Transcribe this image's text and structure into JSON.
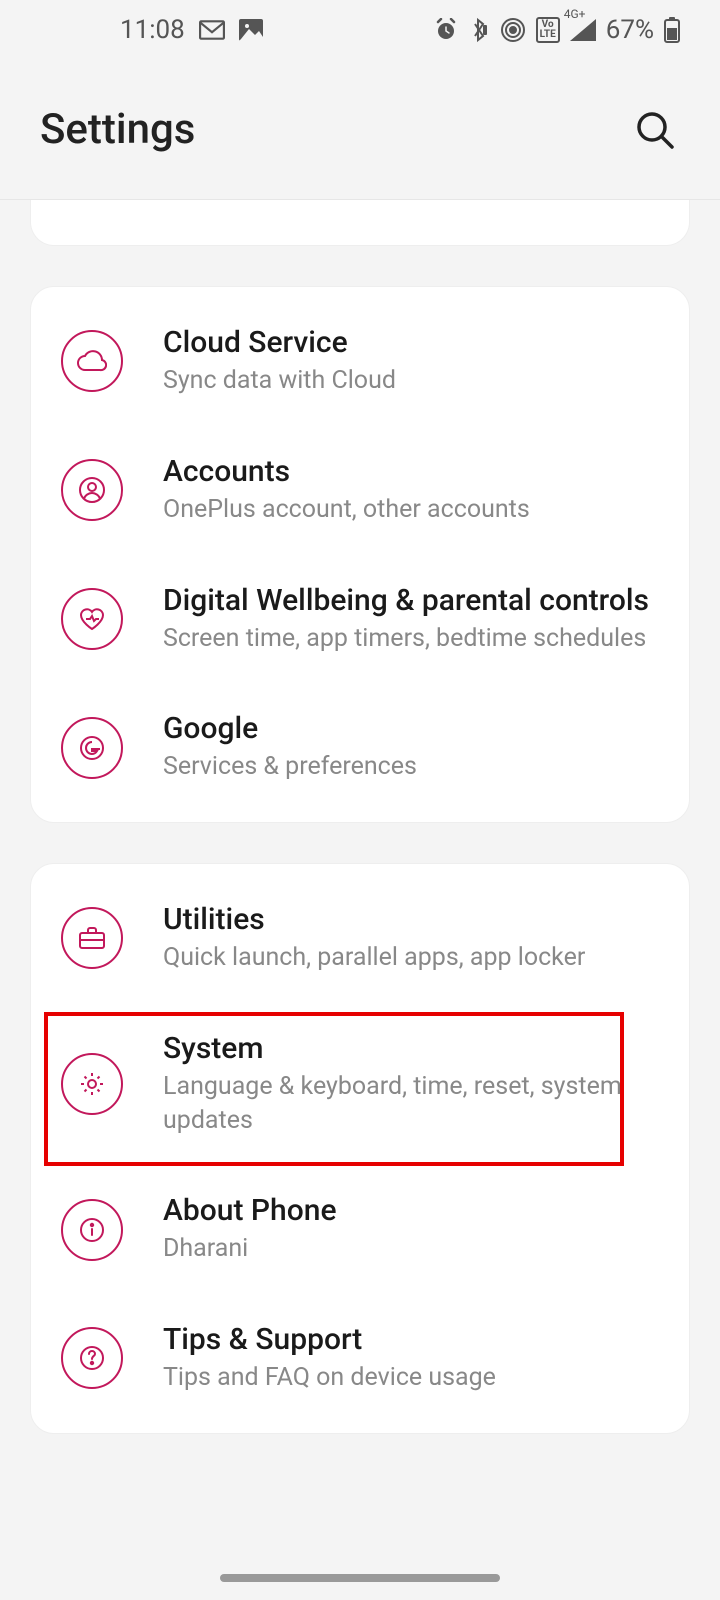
{
  "status": {
    "time": "11:08",
    "battery_pct": "67%",
    "network_label": "4G+"
  },
  "header": {
    "title": "Settings"
  },
  "groups": [
    {
      "items": [
        {
          "icon": "cloud",
          "title": "Cloud Service",
          "subtitle": "Sync data with Cloud"
        },
        {
          "icon": "user",
          "title": "Accounts",
          "subtitle": "OnePlus account, other accounts"
        },
        {
          "icon": "heart",
          "title": "Digital Wellbeing & parental controls",
          "subtitle": "Screen time, app timers, bedtime schedules"
        },
        {
          "icon": "google",
          "title": "Google",
          "subtitle": "Services & preferences"
        }
      ]
    },
    {
      "items": [
        {
          "icon": "briefcase",
          "title": "Utilities",
          "subtitle": "Quick launch, parallel apps, app locker"
        },
        {
          "icon": "gear",
          "title": "System",
          "subtitle": "Language & keyboard, time, reset, system updates",
          "highlighted": true
        },
        {
          "icon": "info",
          "title": "About Phone",
          "subtitle": "Dharani"
        },
        {
          "icon": "question",
          "title": "Tips & Support",
          "subtitle": "Tips and FAQ on device usage"
        }
      ]
    }
  ]
}
